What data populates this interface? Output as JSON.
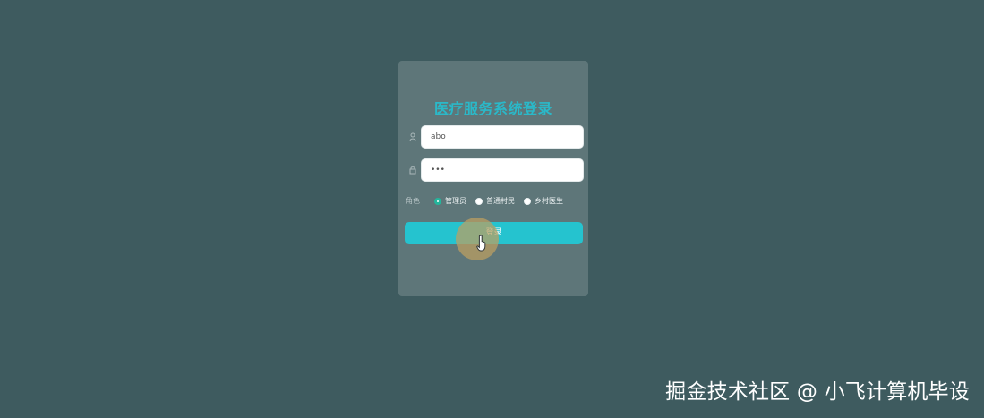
{
  "login": {
    "title": "医疗服务系统登录",
    "username": {
      "value": "abo",
      "icon": "user-icon"
    },
    "password": {
      "value": "•••",
      "icon": "lock-icon"
    },
    "role": {
      "label": "角色",
      "options": [
        {
          "label": "管理员",
          "checked": true
        },
        {
          "label": "普通村民",
          "checked": false
        },
        {
          "label": "乡村医生",
          "checked": false
        }
      ]
    },
    "button_label": "登录"
  },
  "watermark": {
    "text": "掘金技术社区 @ 小飞计算机毕设"
  },
  "colors": {
    "page_background": "#3e5b5f",
    "card_background": "#5e7679",
    "title": "#2ab9c9",
    "button": "#25c3cf",
    "radio_checked": "#24b69c"
  }
}
